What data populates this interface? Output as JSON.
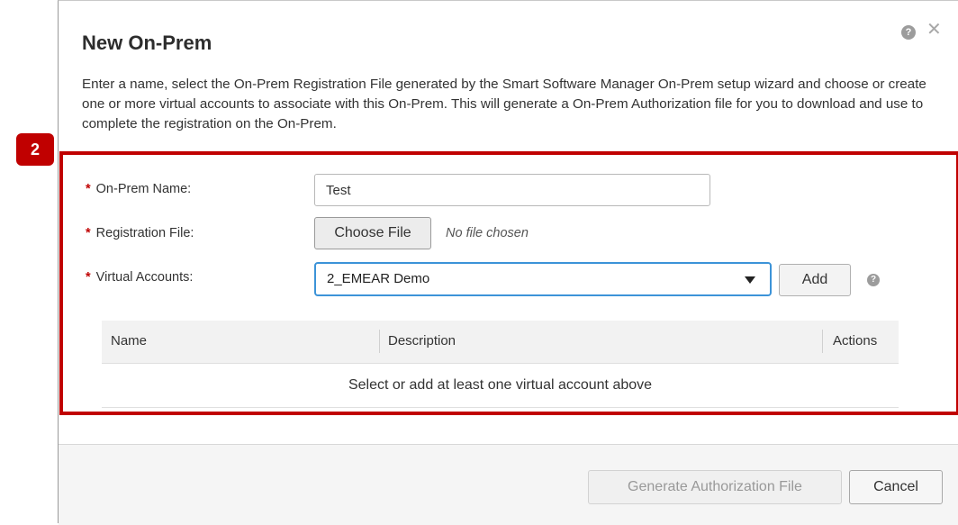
{
  "dialog": {
    "title": "New On-Prem",
    "help_icon": "question-circle-icon",
    "close_icon": "close-icon",
    "description": "Enter a name, select the On-Prem Registration File generated by the Smart Software Manager On-Prem setup wizard and choose or create one or more virtual accounts to associate with this On-Prem. This will generate a On-Prem Authorization file for you to download and use to complete the registration on the On-Prem."
  },
  "step_badge": "2",
  "highlight_color": "#c00000",
  "form": {
    "required_marker": "*",
    "name_label": "On-Prem Name:",
    "name_value": "Test",
    "file_label": "Registration File:",
    "choose_file_label": "Choose File",
    "no_file_text": "No file chosen",
    "va_label": "Virtual Accounts:",
    "va_selected": "2_EMEAR Demo",
    "add_label": "Add",
    "va_help_icon": "question-circle-icon"
  },
  "table": {
    "columns": [
      "Name",
      "Description",
      "Actions"
    ],
    "empty_message": "Select or add at least one virtual account above"
  },
  "footer": {
    "generate_label": "Generate Authorization File",
    "cancel_label": "Cancel"
  }
}
